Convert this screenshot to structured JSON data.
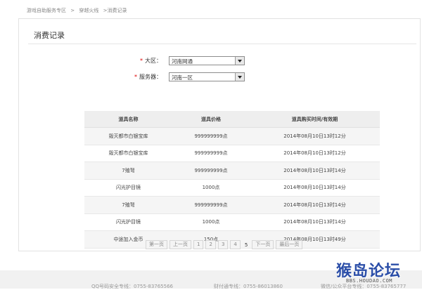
{
  "breadcrumb": [
    "游戏自助服务专区",
    ">",
    "穿越火线",
    ">消费记录"
  ],
  "page_title": "消费记录",
  "form": {
    "region": {
      "required_mark": "*",
      "label": "大区：",
      "value": "河南网通"
    },
    "server": {
      "required_mark": "*",
      "label": "服务器：",
      "value": "河南一区"
    }
  },
  "table": {
    "headers": [
      "道具名称",
      "道具价格",
      "道具购买时间/有效期"
    ],
    "rows": [
      [
        "毁灭都市白银宝库",
        "999999999点",
        "2014年08月10日13时12分"
      ],
      [
        "毁灭都市白银宝库",
        "999999999点",
        "2014年08月10日13时12分"
      ],
      [
        "7殖弩",
        "999999999点",
        "2014年08月10日13时14分"
      ],
      [
        "闪光护目镜",
        "1000点",
        "2014年08月10日13时14分"
      ],
      [
        "7殖弩",
        "999999999点",
        "2014年08月10日13时14分"
      ],
      [
        "闪光护目镜",
        "1000点",
        "2014年08月10日13时14分"
      ],
      [
        "中途加入金币",
        "150点",
        "2014年08月10日13时49分"
      ]
    ]
  },
  "pager": {
    "first": "第一页",
    "prev": "上一页",
    "pages": [
      "1",
      "2",
      "3",
      "4"
    ],
    "current": "5",
    "next": "下一页",
    "last": "最后一页"
  },
  "footer": {
    "safety_line": "QQ号码安全专线：0755-83765566",
    "pay_line": "财付通专线：0755-86013860",
    "wechat_line": "微信/公众平台专线：0755-83765777"
  },
  "watermark": {
    "main": "猴岛论坛",
    "sub": "BBS.HOUDAO.COM"
  },
  "colors": {
    "required": "#dd0000",
    "table_header_bg": "#eeeeee",
    "watermark": "#2b4ea8"
  }
}
